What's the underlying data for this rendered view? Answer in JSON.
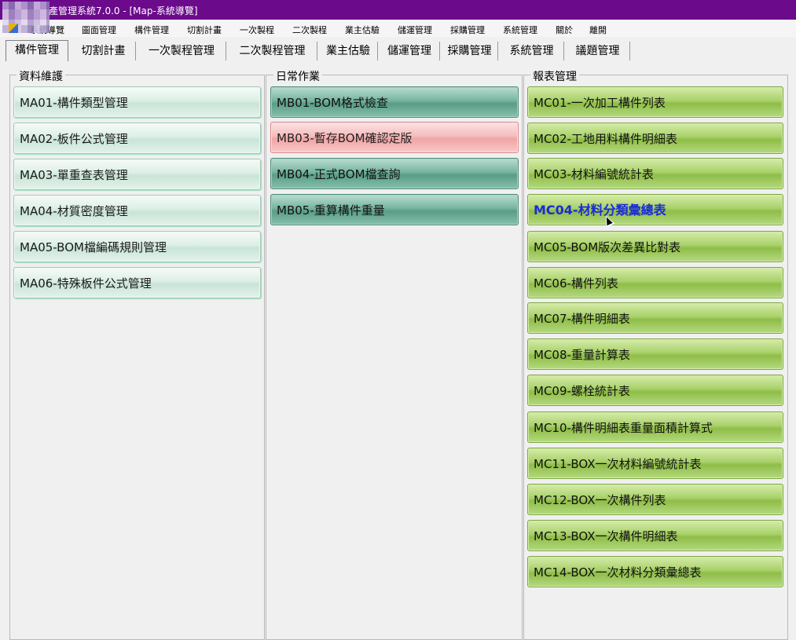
{
  "window": {
    "title": "產管理系統7.0.0 - [Map-系統導覽]"
  },
  "menu": [
    "系統導覽",
    "圖面管理",
    "構件管理",
    "切割計畫",
    "一次製程",
    "二次製程",
    "業主估驗",
    "儲運管理",
    "採購管理",
    "系統管理",
    "關於",
    "離開"
  ],
  "tabs": [
    "構件管理",
    "切割計畫",
    "一次製程管理",
    "二次製程管理",
    "業主估驗",
    "儲運管理",
    "採購管理",
    "系統管理",
    "議題管理"
  ],
  "groups": {
    "left": {
      "label": "資料維護",
      "items": [
        "MA01-構件類型管理",
        "MA02-板件公式管理",
        "MA03-單重查表管理",
        "MA04-材質密度管理",
        "MA05-BOM檔編碼規則管理",
        "MA06-特殊板件公式管理"
      ]
    },
    "middle": {
      "label": "日常作業",
      "items": [
        "MB01-BOM格式檢查",
        "MB03-暫存BOM確認定版",
        "MB04-正式BOM檔查詢",
        "MB05-重算構件重量"
      ]
    },
    "right": {
      "label": "報表管理",
      "items": [
        "MC01-一次加工構件列表",
        "MC02-工地用料構件明細表",
        "MC03-材料編號統計表",
        "MC04-材料分類彙總表",
        "MC05-BOM版次差異比對表",
        "MC06-構件列表",
        "MC07-構件明細表",
        "MC08-重量計算表",
        "MC09-螺栓統計表",
        "MC10-構件明細表重量面積計算式",
        "MC11-BOX一次材料編號統計表",
        "MC12-BOX一次構件列表",
        "MC13-BOX一次構件明細表",
        "MC14-BOX一次材料分類彙總表"
      ]
    }
  },
  "colors": {
    "titlebar": "#6b0b8c",
    "highlight_text": "#1a2bd8"
  }
}
